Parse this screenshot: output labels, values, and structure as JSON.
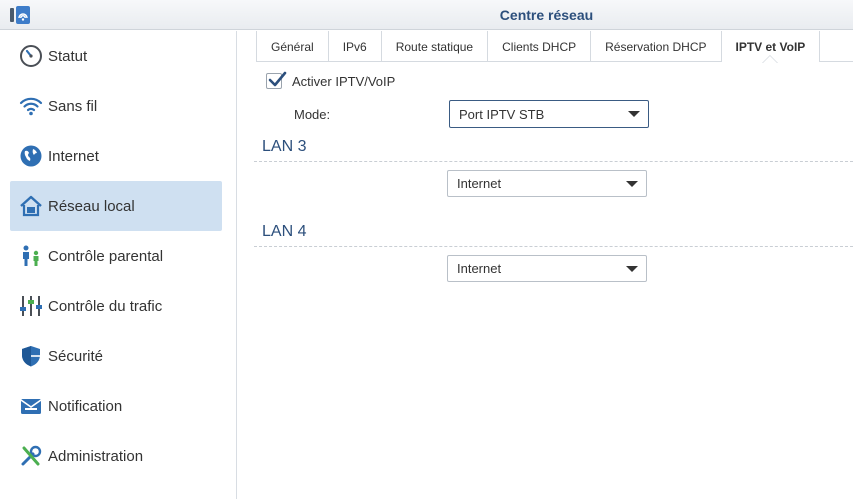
{
  "window": {
    "title": "Centre réseau",
    "app_icon": "wifi-router-icon"
  },
  "sidebar": {
    "items": [
      {
        "label": "Statut",
        "icon": "gauge-icon"
      },
      {
        "label": "Sans fil",
        "icon": "wifi-icon"
      },
      {
        "label": "Internet",
        "icon": "globe-icon"
      },
      {
        "label": "Réseau local",
        "icon": "home-network-icon",
        "active": true
      },
      {
        "label": "Contrôle parental",
        "icon": "family-icon"
      },
      {
        "label": "Contrôle du trafic",
        "icon": "sliders-icon"
      },
      {
        "label": "Sécurité",
        "icon": "shield-icon"
      },
      {
        "label": "Notification",
        "icon": "envelope-icon"
      },
      {
        "label": "Administration",
        "icon": "tools-icon"
      }
    ]
  },
  "tabs": [
    {
      "label": "Général"
    },
    {
      "label": "IPv6"
    },
    {
      "label": "Route statique"
    },
    {
      "label": "Clients DHCP"
    },
    {
      "label": "Réservation DHCP"
    },
    {
      "label": "IPTV et VoIP",
      "active": true
    }
  ],
  "iptv": {
    "enable_label": "Activer IPTV/VoIP",
    "enabled": true,
    "mode_label": "Mode:",
    "mode_value": "Port IPTV STB"
  },
  "lan3": {
    "title": "LAN 3",
    "value": "Internet"
  },
  "lan4": {
    "title": "LAN 4",
    "value": "Internet"
  },
  "colors": {
    "accent": "#2c4f7c",
    "active_bg": "#cfe0f1",
    "icon_blue": "#2f6fb3"
  }
}
